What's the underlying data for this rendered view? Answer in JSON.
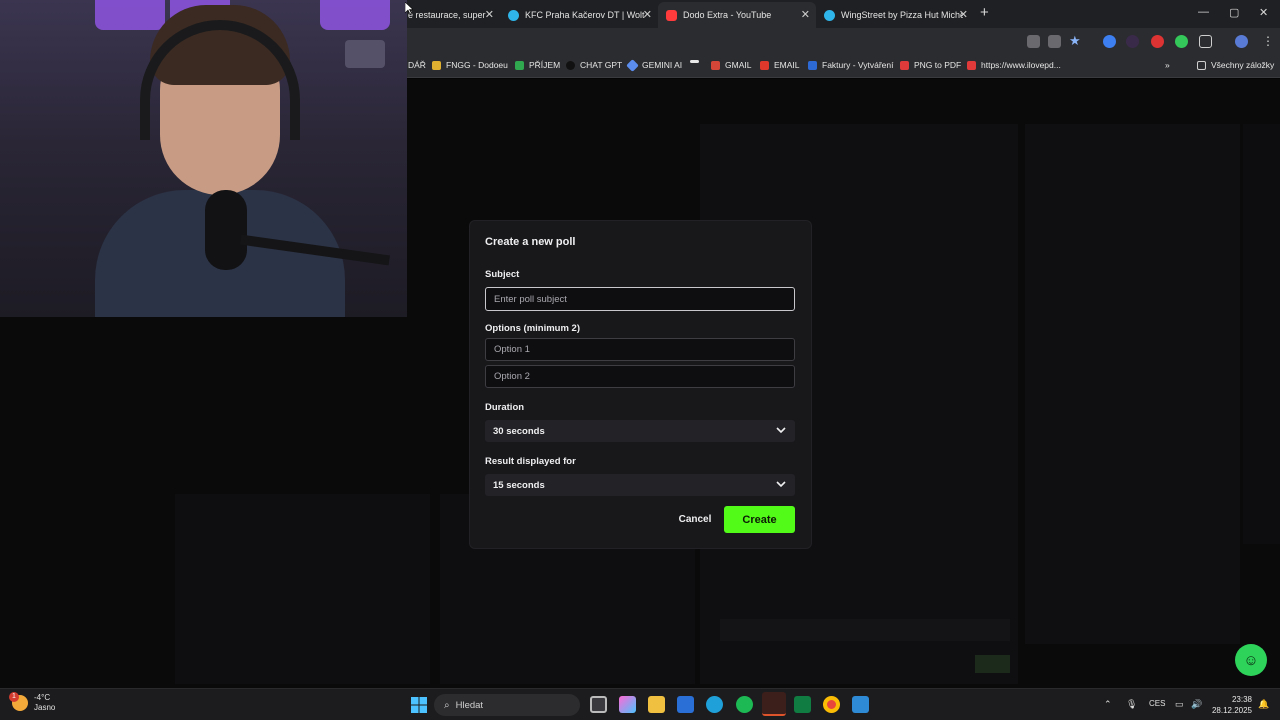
{
  "browser": {
    "tabs": [
      {
        "label": "é restaurace, super",
        "icon_color": "#2b2c2f"
      },
      {
        "label": "KFC Praha Kačerov DT | Wolt | D",
        "icon_color": "#2fb5e9"
      },
      {
        "label": "Dodo Extra - YouTube",
        "icon_color": "#ff3b3b"
      },
      {
        "label": "WingStreet by Pizza Hut Miche",
        "icon_color": "#2fb5e9"
      }
    ],
    "new_tab": "+",
    "bookmarks": [
      {
        "label": "DÁŘ",
        "icon_color": "#2b2c2f"
      },
      {
        "label": "FNGG - Dodoeu",
        "icon_color": "#e0b030"
      },
      {
        "label": "PŘÍJEM",
        "icon_color": "#2fa84f"
      },
      {
        "label": "CHAT GPT",
        "icon_color": "#1a1a1a"
      },
      {
        "label": "GEMINI AI",
        "icon_color": "#5b8def"
      },
      {
        "label": "GMAIL",
        "icon_color": "#d44638"
      },
      {
        "label": "EMAIL",
        "icon_color": "#e0382b"
      },
      {
        "label": "Faktury - Vytváření",
        "icon_color": "#2d6ad6"
      },
      {
        "label": "PNG to PDF",
        "icon_color": "#e03a3a"
      },
      {
        "label": "https://www.ilovepd...",
        "icon_color": "#e03a3a"
      }
    ],
    "all_bookmarks": "Všechny záložky"
  },
  "modal": {
    "title": "Create a new poll",
    "subject_label": "Subject",
    "subject_placeholder": "Enter poll subject",
    "options_label": "Options (minimum 2)",
    "option1_placeholder": "Option 1",
    "option2_placeholder": "Option 2",
    "duration_label": "Duration",
    "duration_value": "30 seconds",
    "result_label": "Result displayed for",
    "result_value": "15 seconds",
    "cancel": "Cancel",
    "create": "Create"
  },
  "taskbar": {
    "temperature": "-4°C",
    "weather": "Jasno",
    "weather_badge": "1",
    "search_placeholder": "Hledat",
    "language": "CES",
    "time": "23:38",
    "date": "28.12.2025"
  },
  "colors": {
    "accent": "#53fc18",
    "modal_bg": "#18181b",
    "support": "#2ed35a"
  }
}
